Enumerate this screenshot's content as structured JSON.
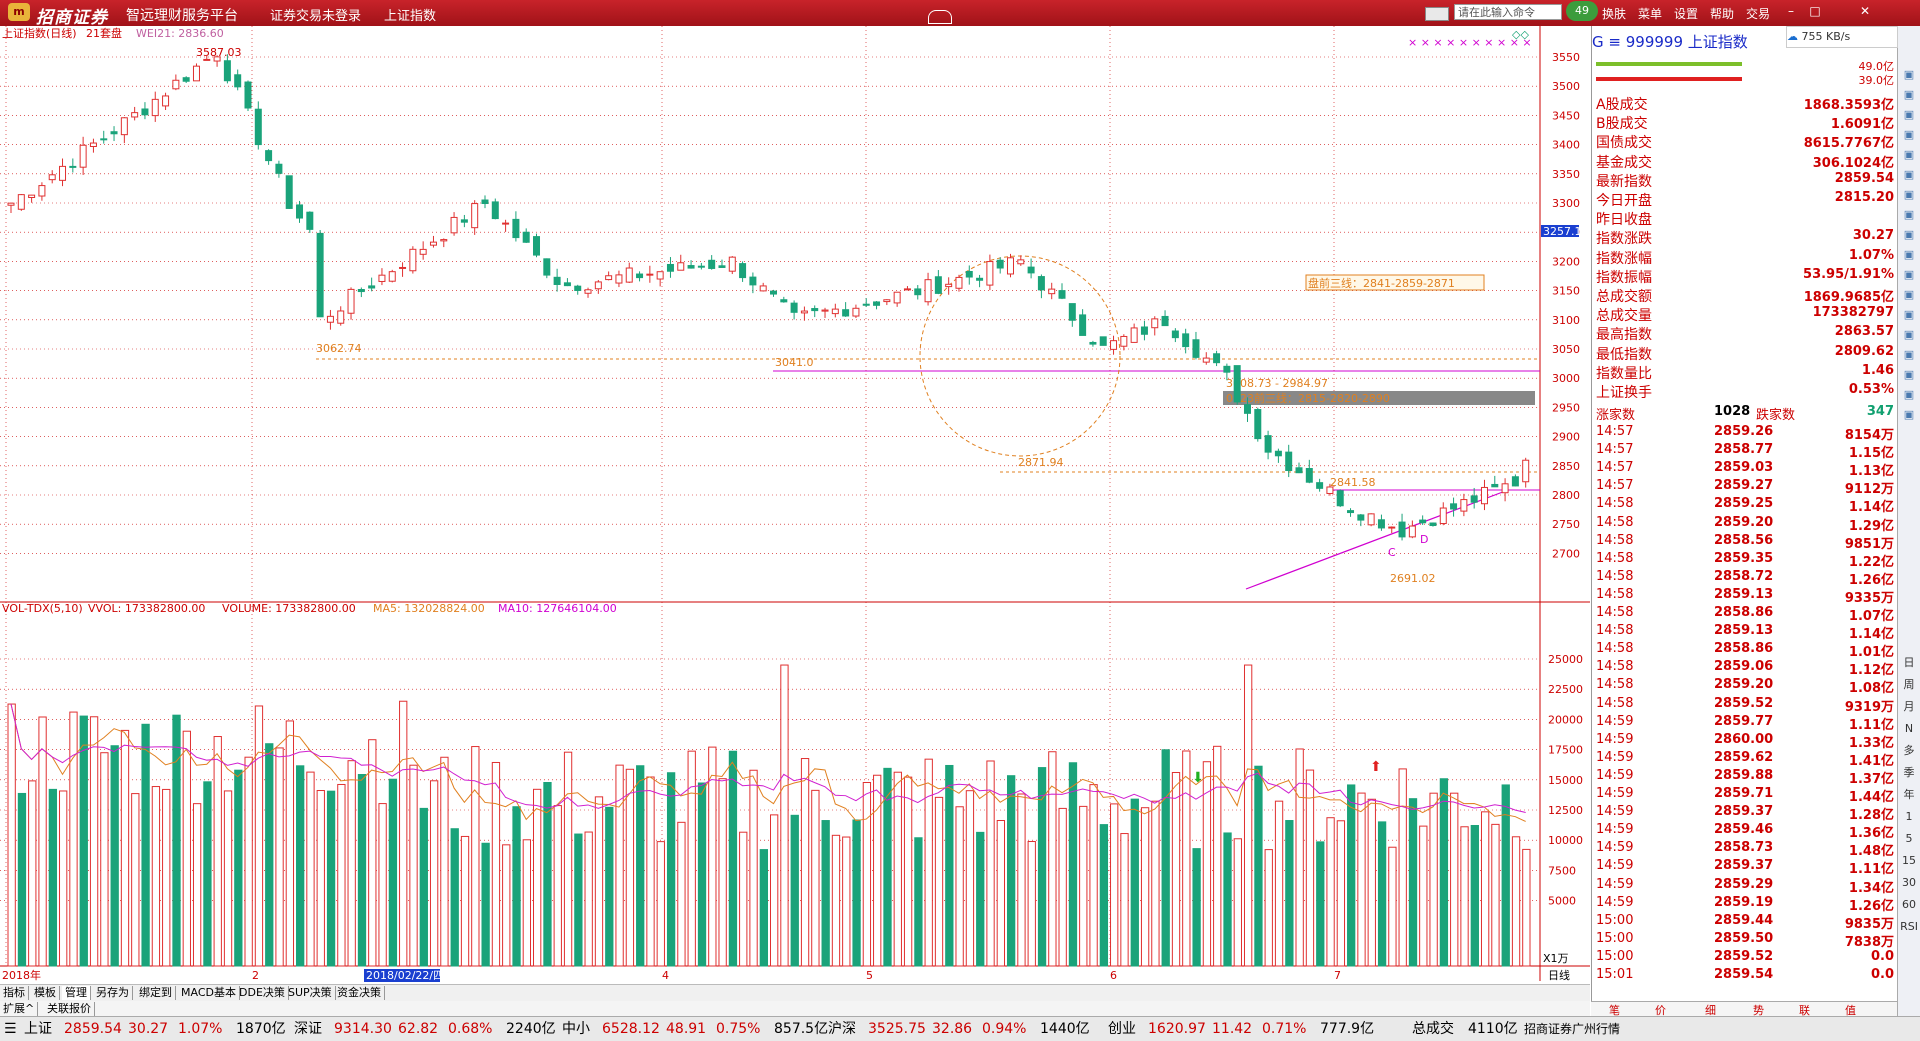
{
  "titlebar": {
    "logo_badge": "m",
    "brand": "招商证券",
    "tagline": "智远理财服务平台",
    "login_status": "证券交易未登录",
    "current_index": "上证指数",
    "search_placeholder": "请在此输入命令",
    "notify_count": "49",
    "menus": [
      "换肤",
      "菜单",
      "设置",
      "帮助",
      "交易"
    ]
  },
  "chart": {
    "header": {
      "name": "上证指数(日线)",
      "cycle": "21套盘",
      "wei_label": "WEI21: 2836.60",
      "x_marks": "× × × × × × × × × ×"
    },
    "y_ticks": [
      "3550",
      "3500",
      "3450",
      "3400",
      "3350",
      "3300",
      "3250",
      "3200",
      "3150",
      "3100",
      "3050",
      "3000",
      "2950",
      "2900",
      "2850",
      "2800",
      "2750",
      "2700"
    ],
    "current_price_tag": "3257.1",
    "annotations": {
      "high": "3587.03",
      "low1": "3062.74",
      "mid": "3041.0",
      "pre_line": "盘前三线：2841-2859-2871",
      "range": "3008.73 - 2984.97",
      "line0723": "0723前三线：2815-2820-2890",
      "l2871": "2871.94",
      "l2841": "2841.58",
      "c": "C",
      "d": "D",
      "low2": "2691.02"
    },
    "date_ticks": [
      "2018年",
      "2",
      "4",
      "5",
      "6",
      "7"
    ],
    "cursor_date": "2018/02/22/四",
    "cycle_label": "日线"
  },
  "volume": {
    "header": {
      "name": "VOL-TDX(5,10)",
      "vvol": "VVOL: 173382800.00",
      "volume": "VOLUME: 173382800.00",
      "ma5": "MA5: 132028824.00",
      "ma10": "MA10: 127646104.00"
    },
    "y_ticks": [
      "25000",
      "22500",
      "20000",
      "17500",
      "15000",
      "12500",
      "10000",
      "7500",
      "5000"
    ],
    "unit": "X1万"
  },
  "chart_data": [
    {
      "type": "candlestick",
      "title": "上证指数(日线)",
      "x_labels": [
        "2018年",
        "2",
        "4",
        "5",
        "6",
        "7"
      ],
      "ylim": [
        2680,
        3590
      ],
      "series": [
        {
          "name": "上证指数",
          "high": 3587.03,
          "low": 2691.02,
          "last_close": 2859.54
        }
      ]
    },
    {
      "type": "bar",
      "title": "VOL-TDX(5,10)",
      "ylim": [
        0,
        27500
      ],
      "series": [
        {
          "name": "VOLUME",
          "last": 17338.28
        },
        {
          "name": "MA5",
          "last": 13202.88
        },
        {
          "name": "MA10",
          "last": 12764.61
        }
      ]
    }
  ],
  "quote": {
    "code": "G ≡ 999999 上证指数",
    "bars": [
      "49.0亿",
      "39.0亿"
    ],
    "rows": [
      {
        "k": "A股成交",
        "v": "1868.3593亿",
        "c": "#c00"
      },
      {
        "k": "B股成交",
        "v": "1.6091亿",
        "c": "#c00"
      },
      {
        "k": "国债成交",
        "v": "8615.7767亿",
        "c": "#c00"
      },
      {
        "k": "基金成交",
        "v": "306.1024亿",
        "c": "#c00"
      },
      {
        "k": "最新指数",
        "v": "2859.54",
        "c": "#c00"
      },
      {
        "k": "今日开盘",
        "v": "2815.20",
        "c": "#c00"
      },
      {
        "k": "昨日收盘",
        "v": "",
        "c": "#c00"
      },
      {
        "k": "指数涨跌",
        "v": "30.27",
        "c": "#c00"
      },
      {
        "k": "指数涨幅",
        "v": "1.07%",
        "c": "#c00"
      },
      {
        "k": "指数振幅",
        "v": "53.95/1.91%",
        "c": "#c00"
      },
      {
        "k": "总成交额",
        "v": "1869.9685亿",
        "c": "#c00"
      },
      {
        "k": "总成交量",
        "v": "173382797",
        "c": "#c00"
      },
      {
        "k": "最高指数",
        "v": "2863.57",
        "c": "#c00"
      },
      {
        "k": "最低指数",
        "v": "2809.62",
        "c": "#c00"
      },
      {
        "k": "指数量比",
        "v": "1.46",
        "c": "#c00"
      },
      {
        "k": "上证换手",
        "v": "0.53%",
        "c": "#c00"
      }
    ],
    "breadth": {
      "up_label": "涨家数",
      "up": "1028",
      "down_label": "跌家数",
      "down": "347"
    },
    "ticks": [
      [
        "14:57",
        "2859.26",
        "8154万"
      ],
      [
        "14:57",
        "2858.77",
        "1.15亿"
      ],
      [
        "14:57",
        "2859.03",
        "1.13亿"
      ],
      [
        "14:57",
        "2859.27",
        "9112万"
      ],
      [
        "14:58",
        "2859.25",
        "1.14亿"
      ],
      [
        "14:58",
        "2859.20",
        "1.29亿"
      ],
      [
        "14:58",
        "2858.56",
        "9851万"
      ],
      [
        "14:58",
        "2859.35",
        "1.22亿"
      ],
      [
        "14:58",
        "2858.72",
        "1.26亿"
      ],
      [
        "14:58",
        "2859.13",
        "9335万"
      ],
      [
        "14:58",
        "2858.86",
        "1.07亿"
      ],
      [
        "14:58",
        "2859.13",
        "1.14亿"
      ],
      [
        "14:58",
        "2858.86",
        "1.01亿"
      ],
      [
        "14:58",
        "2859.06",
        "1.12亿"
      ],
      [
        "14:58",
        "2859.20",
        "1.08亿"
      ],
      [
        "14:58",
        "2859.52",
        "9319万"
      ],
      [
        "14:59",
        "2859.77",
        "1.11亿"
      ],
      [
        "14:59",
        "2860.00",
        "1.33亿"
      ],
      [
        "14:59",
        "2859.62",
        "1.41亿"
      ],
      [
        "14:59",
        "2859.88",
        "1.37亿"
      ],
      [
        "14:59",
        "2859.71",
        "1.44亿"
      ],
      [
        "14:59",
        "2859.37",
        "1.28亿"
      ],
      [
        "14:59",
        "2859.46",
        "1.36亿"
      ],
      [
        "14:59",
        "2858.73",
        "1.48亿"
      ],
      [
        "14:59",
        "2859.37",
        "1.11亿"
      ],
      [
        "14:59",
        "2859.29",
        "1.34亿"
      ],
      [
        "14:59",
        "2859.19",
        "1.26亿"
      ],
      [
        "15:00",
        "2859.44",
        "9835万"
      ],
      [
        "15:00",
        "2859.50",
        "7838万"
      ],
      [
        "15:00",
        "2859.52",
        "0.0"
      ],
      [
        "15:01",
        "2859.54",
        "0.0"
      ]
    ],
    "tabs": [
      "笔",
      "价",
      "细",
      "势",
      "联",
      "值"
    ]
  },
  "net_speed": "755 KB/s",
  "tools": [
    "日",
    "周",
    "月",
    "N",
    "多",
    "季",
    "年",
    "1",
    "5",
    "15",
    "30",
    "60",
    "RSI"
  ],
  "bottom_tabs": [
    "指标",
    "模板",
    "管理",
    "另存为",
    "绑定到",
    "MACD基本",
    "DDE决策",
    "SUP决策",
    "资金决策"
  ],
  "sub_tabs": [
    "扩展^",
    "关联报价"
  ],
  "statusbar": [
    {
      "label": "上证",
      "price": "2859.54",
      "chg": "30.27",
      "pct": "1.07%",
      "amt": "1870亿"
    },
    {
      "label": "深证",
      "price": "9314.30",
      "chg": "62.82",
      "pct": "0.68%",
      "amt": "2240亿"
    },
    {
      "label": "中小",
      "price": "6528.12",
      "chg": "48.91",
      "pct": "0.75%",
      "amt": "857.5亿"
    },
    {
      "label": "沪深",
      "price": "3525.75",
      "chg": "32.86",
      "pct": "0.94%",
      "amt": "1440亿"
    },
    {
      "label": "创业",
      "price": "1620.97",
      "chg": "11.42",
      "pct": "0.71%",
      "amt": "777.9亿"
    }
  ],
  "status_total": {
    "label": "总成交",
    "value": "4110亿"
  },
  "status_broker": "招商证券广州行情",
  "colors": {
    "up": "#e03030",
    "down": "#1aa37a",
    "ma5": "#e08020",
    "ma10": "#d020d0",
    "accent": "#c8232a"
  }
}
